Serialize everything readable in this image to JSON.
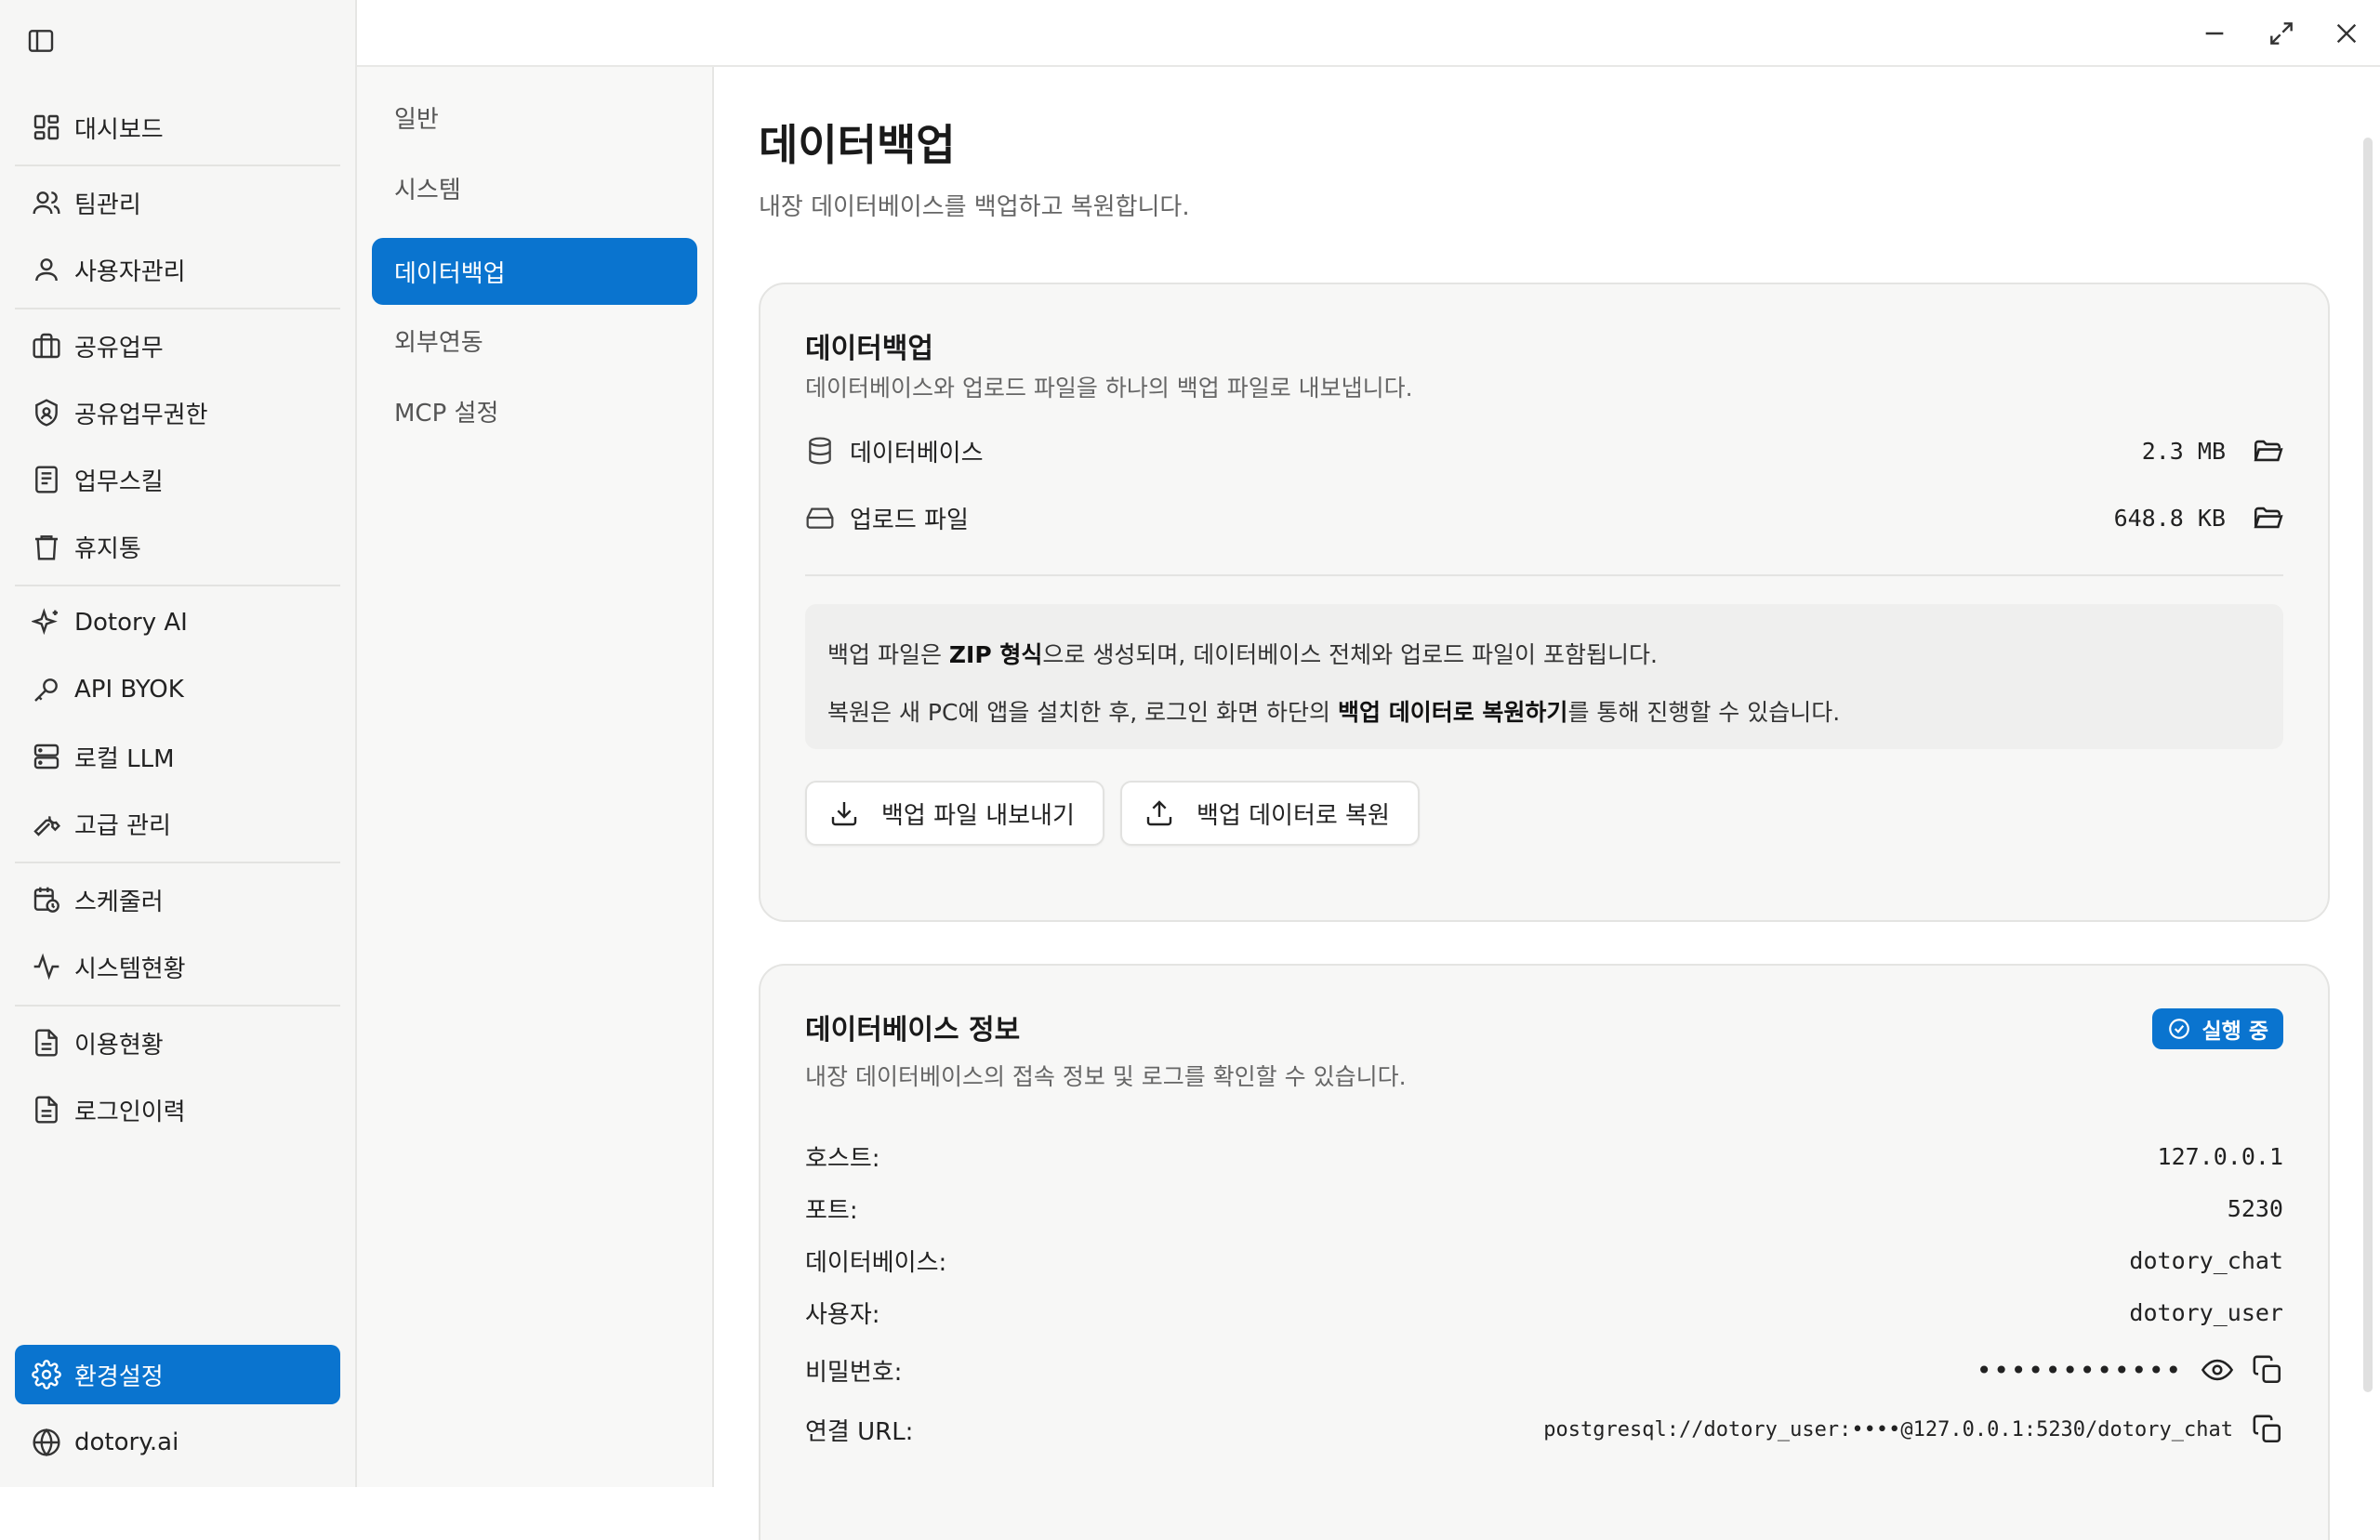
{
  "sidebar": {
    "items": [
      {
        "label": "대시보드"
      },
      {
        "label": "팀관리"
      },
      {
        "label": "사용자관리"
      },
      {
        "label": "공유업무"
      },
      {
        "label": "공유업무권한"
      },
      {
        "label": "업무스킬"
      },
      {
        "label": "휴지통"
      },
      {
        "label": "Dotory AI"
      },
      {
        "label": "API BYOK"
      },
      {
        "label": "로컬 LLM"
      },
      {
        "label": "고급 관리"
      },
      {
        "label": "스케줄러"
      },
      {
        "label": "시스템현황"
      },
      {
        "label": "이용현황"
      },
      {
        "label": "로그인이력"
      }
    ],
    "settings_label": "환경설정",
    "website_label": "dotory.ai"
  },
  "subnav": {
    "items": [
      {
        "label": "일반"
      },
      {
        "label": "시스템"
      },
      {
        "label": "데이터백업"
      },
      {
        "label": "외부연동"
      },
      {
        "label": "MCP 설정"
      }
    ],
    "active_index": 2
  },
  "page": {
    "title": "데이터백업",
    "subtitle": "내장 데이터베이스를 백업하고 복원합니다."
  },
  "backup_card": {
    "title": "데이터백업",
    "subtitle": "데이터베이스와 업로드 파일을 하나의 백업 파일로 내보냅니다.",
    "files": [
      {
        "label": "데이터베이스",
        "size": "2.3 MB",
        "icon": "database-icon"
      },
      {
        "label": "업로드 파일",
        "size": "648.8 KB",
        "icon": "hard-drive-icon"
      }
    ],
    "note": {
      "line1_pre": "백업 파일은 ",
      "line1_bold": "ZIP 형식",
      "line1_post": "으로 생성되며, 데이터베이스 전체와 업로드 파일이 포함됩니다.",
      "line2_pre": "복원은 새 PC에 앱을 설치한 후, 로그인 화면 하단의 ",
      "line2_bold": "백업 데이터로 복원하기",
      "line2_post": "를 통해 진행할 수 있습니다."
    },
    "export_button": "백업 파일 내보내기",
    "restore_button": "백업 데이터로 복원"
  },
  "db_card": {
    "title": "데이터베이스 정보",
    "subtitle": "내장 데이터베이스의 접속 정보 및 로그를 확인할 수 있습니다.",
    "status_badge": "실행 중",
    "host_label": "호스트:",
    "host": "127.0.0.1",
    "port_label": "포트:",
    "port": "5230",
    "database_label": "데이터베이스:",
    "database": "dotory_chat",
    "user_label": "사용자:",
    "user": "dotory_user",
    "password_label": "비밀번호:",
    "password_mask": "••••••••••••",
    "url_label": "연결 URL:",
    "url": "postgresql://dotory_user:••••@127.0.0.1:5230/dotory_chat"
  },
  "colors": {
    "accent": "#0a74cf",
    "sidebar_bg": "#f6f6f5",
    "card_bg": "#f7f7f6"
  }
}
